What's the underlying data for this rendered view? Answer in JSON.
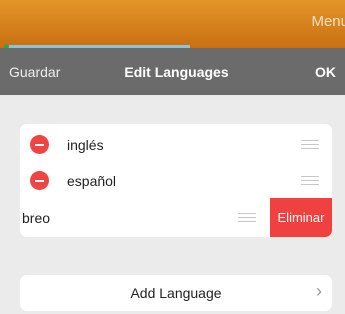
{
  "top_bar": {
    "menu_text": "Menu"
  },
  "navbar": {
    "save_label": "Guardar",
    "title": "Edit Languages",
    "ok_label": "OK"
  },
  "languages": [
    {
      "label": "inglés"
    },
    {
      "label": "español"
    },
    {
      "label": "breo",
      "delete_label": "Eliminar"
    }
  ],
  "add_language_label": "Add Language",
  "icons": {
    "remove": "minus-circle-icon",
    "reorder": "drag-handle-icon",
    "chevron": "chevron-right-icon"
  },
  "colors": {
    "top_bar": "#d98320",
    "navbar": "#6b6b6b",
    "delete": "#f04040",
    "remove_icon": "#ef4444",
    "background": "#ebebeb"
  }
}
